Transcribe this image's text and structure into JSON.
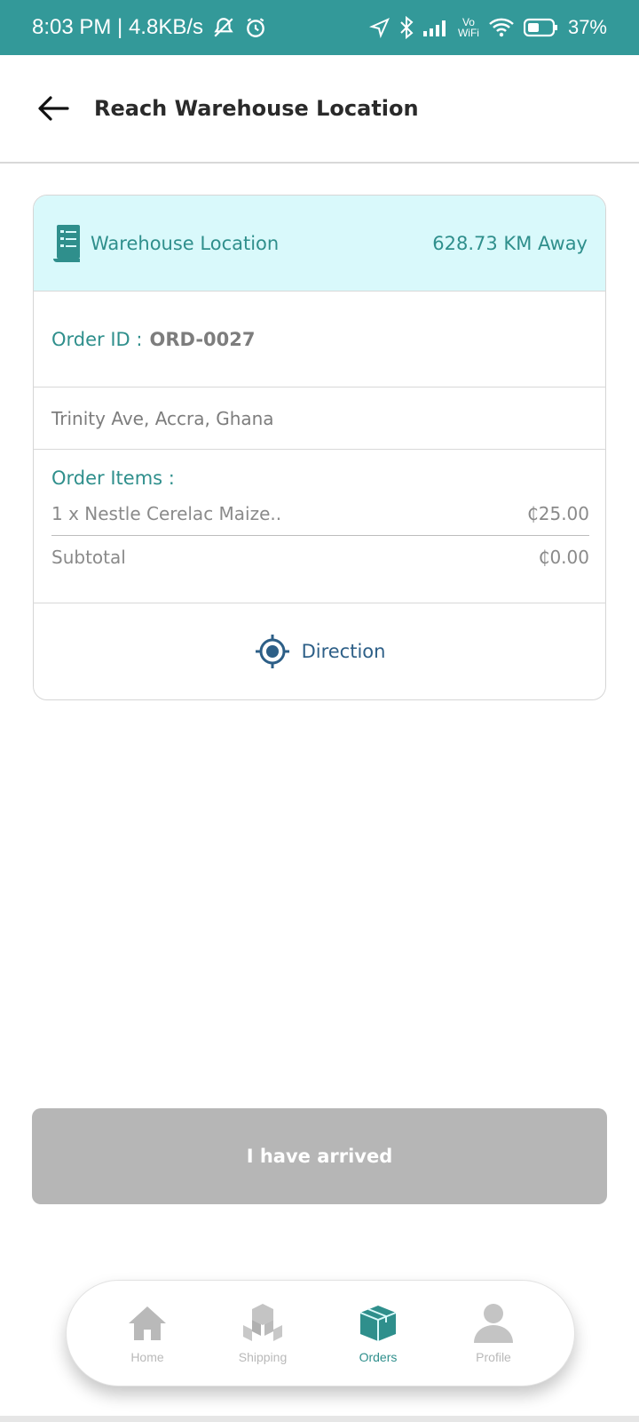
{
  "status_bar": {
    "time_speed": "8:03 PM | 4.8KB/s",
    "vowifi": "Vo\nWiFi",
    "battery": "37%"
  },
  "header": {
    "title": "Reach Warehouse Location"
  },
  "card": {
    "warehouse_label": "Warehouse Location",
    "distance": "628.73 KM Away",
    "order_prefix": "Order ID :",
    "order_id": "ORD-0027",
    "address": "Trinity Ave, Accra, Ghana",
    "items_title": "Order Items :",
    "items": [
      {
        "name": "1 x Nestle Cerelac Maize..",
        "price": "₵25.00"
      }
    ],
    "subtotal_label": "Subtotal",
    "subtotal_value": "₵0.00",
    "direction_label": "Direction"
  },
  "action": {
    "arrived_label": "I have arrived"
  },
  "nav": {
    "items": [
      {
        "label": "Home"
      },
      {
        "label": "Shipping"
      },
      {
        "label": "Orders"
      },
      {
        "label": "Profile"
      }
    ],
    "active": "Orders"
  },
  "colors": {
    "status_bar": "#339999",
    "accent": "#2f8f8c",
    "card_header_bg": "#d9f9fb",
    "direction": "#2d5f87",
    "button_disabled": "#b6b6b6"
  }
}
